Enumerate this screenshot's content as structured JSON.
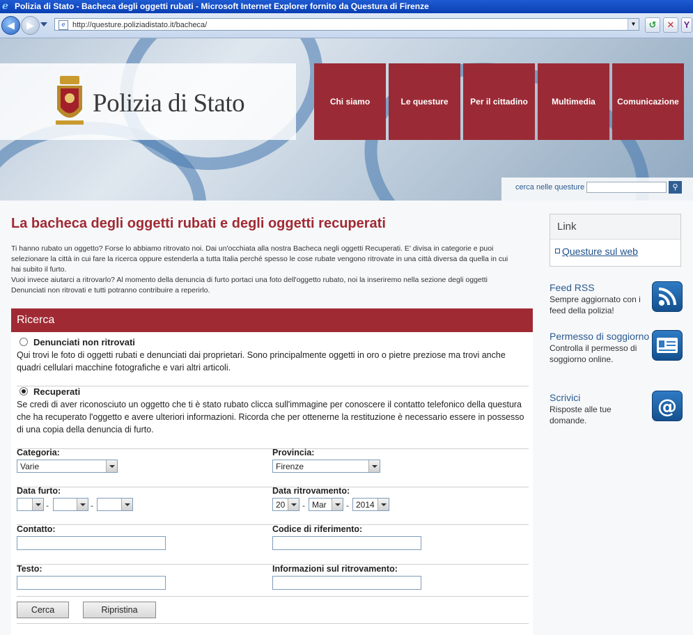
{
  "browser": {
    "title": "Polizia di Stato - Bacheca degli oggetti rubati - Microsoft Internet Explorer fornito da Questura di Firenze",
    "url": "http://questure.poliziadistato.it/bacheca/"
  },
  "header": {
    "logo_text": "Polizia di Stato",
    "menu": [
      "Chi siamo",
      "Le questure",
      "Per il cittadino",
      "Multimedia",
      "Comunicazione"
    ],
    "search_label": "cerca nelle questure"
  },
  "main": {
    "title": "La bacheca degli oggetti rubati e degli oggetti recuperati",
    "intro_lines": [
      "Ti hanno rubato un oggetto? Forse lo abbiamo ritrovato noi. Dai un'occhiata alla nostra Bacheca negli oggetti Recuperati. E' divisa in categorie e puoi",
      "selezionare la città in cui fare la ricerca oppure estenderla a tutta Italia perché spesso le cose rubate vengono ritrovate in una città diversa da quella in cui",
      "hai subito il furto.",
      "Vuoi invece aiutarci a ritrovarlo? Al momento della denuncia di furto portaci una foto dell'oggetto rubato, noi la inseriremo nella sezione degli oggetti",
      "Denunciati non ritrovati e tutti potranno contribuire a reperirlo."
    ]
  },
  "search": {
    "header": "Ricerca",
    "option1_label": "Denunciati non ritrovati",
    "option1_desc": "Qui trovi le foto di oggetti rubati e denunciati dai proprietari. Sono principalmente oggetti in oro o pietre preziose ma trovi anche quadri cellulari macchine fotografiche e vari altri articoli.",
    "option2_label": "Recuperati",
    "option2_desc": "Se credi di aver riconosciuto un oggetto che ti è stato rubato clicca sull'immagine per conoscere il contatto telefonico della questura che ha recuperato l'oggetto e avere ulteriori informazioni. Ricorda che per ottenerne la restituzione è necessario essere in possesso di una copia della denuncia di furto.",
    "selected_option": "Recuperati",
    "categoria_label": "Categoria:",
    "categoria_value": "Varie",
    "provincia_label": "Provincia:",
    "provincia_value": "Firenze",
    "data_furto_label": "Data furto:",
    "data_furto_values": [
      "",
      "",
      ""
    ],
    "data_ritrovamento_label": "Data ritrovamento:",
    "data_ritrovamento_day": "20",
    "data_ritrovamento_month": "Mar",
    "data_ritrovamento_year": "2014",
    "date_separator": "-",
    "contatto_label": "Contatto:",
    "codice_label": "Codice di riferimento:",
    "testo_label": "Testo:",
    "informazioni_label": "Informazioni sul ritrovamento:",
    "cerca_button": "Cerca",
    "ripristina_button": "Ripristina"
  },
  "sidebar": {
    "link_header": "Link",
    "link_item": "Questure sul web",
    "items": [
      {
        "title": "Feed RSS",
        "desc": "Sempre aggiornato con i feed della polizia!",
        "icon": "rss-icon"
      },
      {
        "title": "Permesso di soggiorno",
        "desc": "Controlla il permesso di soggiorno online.",
        "icon": "id-card-icon"
      },
      {
        "title": "Scrivici",
        "desc": "Risposte alle tue domande.",
        "icon": "email-at-icon"
      }
    ]
  },
  "colors": {
    "accent": "#a02a33",
    "menu_bg": "#9a2b36",
    "link": "#2a5a8f"
  }
}
